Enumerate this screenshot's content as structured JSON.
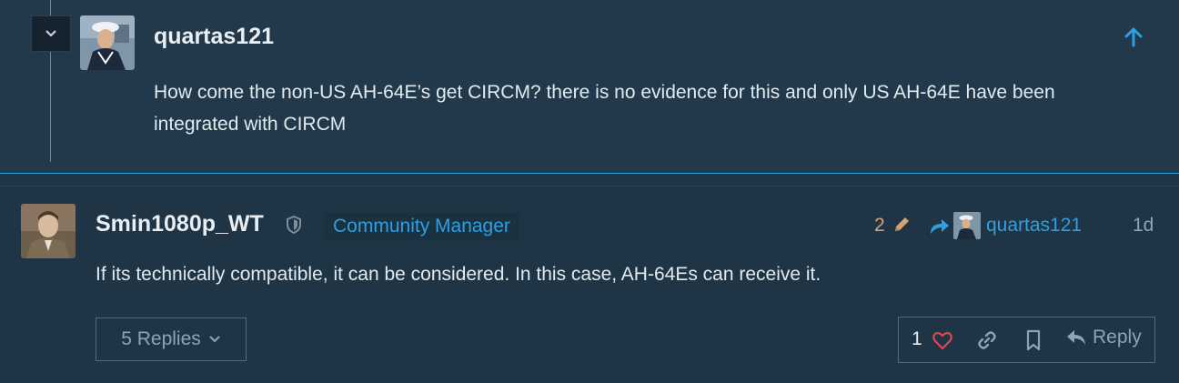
{
  "quoted_post": {
    "username": "quartas121",
    "text": "How come the non-US AH-64E’s get CIRCM? there is no evidence for this and only US AH-64E have been integrated with CIRCM"
  },
  "post": {
    "username": "Smin1080p_WT",
    "role": "Community Manager",
    "edit_count": "2",
    "reply_to_username": "quartas121",
    "date": "1d",
    "text": "If its technically compatible, it can be considered. In this case, AH-64Es can receive it.",
    "replies_label": "5 Replies",
    "like_count": "1",
    "reply_label": "Reply"
  },
  "colors": {
    "accent": "#2e9fe0",
    "heart": "#e0454f",
    "edit": "#d4a373"
  }
}
